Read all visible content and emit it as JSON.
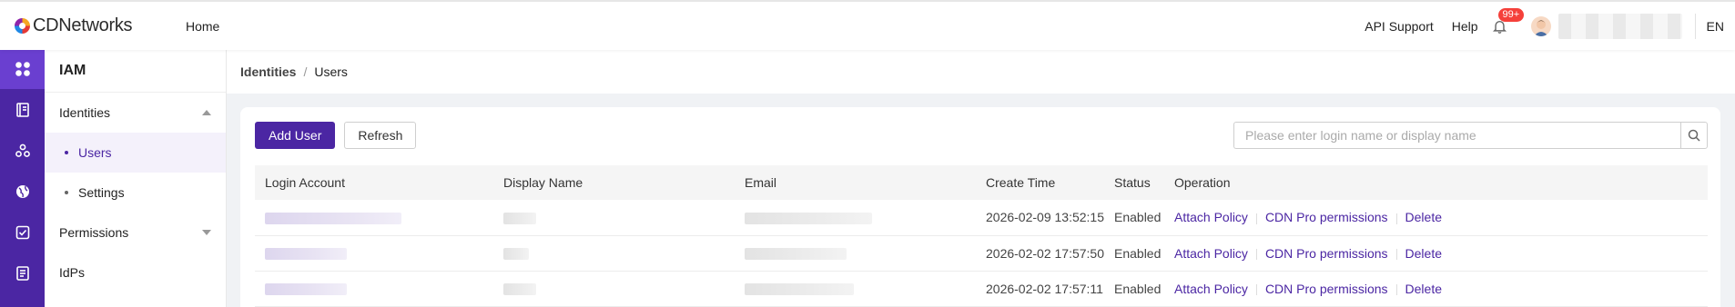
{
  "header": {
    "logo_text": "CDNetworks",
    "nav_home": "Home",
    "api_support": "API Support",
    "help": "Help",
    "notifications_badge": "99+",
    "language": "EN"
  },
  "sidebar": {
    "title": "IAM",
    "groups": [
      {
        "label": "Identities",
        "expanded": true,
        "items": [
          {
            "label": "Users",
            "active": true
          },
          {
            "label": "Settings",
            "active": false
          }
        ]
      },
      {
        "label": "Permissions",
        "expanded": false
      },
      {
        "label": "IdPs"
      }
    ]
  },
  "rail": {
    "icons": [
      "dashboard-icon",
      "book-icon",
      "network-icon",
      "globe-icon",
      "checklist-icon",
      "report-icon"
    ]
  },
  "breadcrumb": {
    "parent": "Identities",
    "separator": "/",
    "current": "Users"
  },
  "toolbar": {
    "add_user": "Add User",
    "refresh": "Refresh",
    "search_placeholder": "Please enter login name or display name"
  },
  "table": {
    "columns": [
      "Login Account",
      "Display Name",
      "Email",
      "Create Time",
      "Status",
      "Operation"
    ],
    "operations": [
      "Attach Policy",
      "CDN Pro permissions",
      "Delete"
    ],
    "rows": [
      {
        "create_time": "2026-02-09 13:52:15",
        "status": "Enabled"
      },
      {
        "create_time": "2026-02-02 17:57:50",
        "status": "Enabled"
      },
      {
        "create_time": "2026-02-02 17:57:11",
        "status": "Enabled"
      }
    ]
  },
  "colors": {
    "brand": "#4b26a3",
    "badge": "#f5403a"
  }
}
